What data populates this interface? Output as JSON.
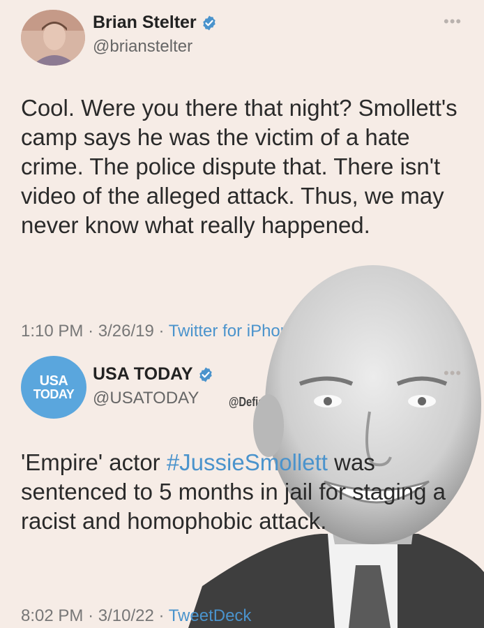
{
  "tweets": [
    {
      "name": "Brian Stelter",
      "handle": "@brianstelter",
      "text": "Cool. Were you there that night? Smollett's camp says he was the victim of a hate crime. The police dispute that. There isn't video of the alleged attack. Thus, we may never know what really happened.",
      "time": "1:10 PM",
      "date": "3/26/19",
      "source": "Twitter for iPhone",
      "more_icon": "more-dots-icon",
      "verified_icon": "verified-badge-icon"
    },
    {
      "name": "USA TODAY",
      "handle": "@USATODAY",
      "logo_line1": "USA",
      "logo_line2": "TODAY",
      "text_before": "'Empire' actor ",
      "hashtag": "#JussieSmollett",
      "text_after": " was sentenced to 5 months in jail for staging a racist and homophobic attack.",
      "time": "8:02 PM",
      "date": "3/10/22",
      "source": "TweetDeck",
      "more_icon": "more-dots-icon",
      "verified_icon": "verified-badge-icon"
    }
  ],
  "separator": "·",
  "watermark": "@DefiantLs",
  "colors": {
    "background": "#f6ece6",
    "link": "#4a93cc",
    "verified": "#4a93cc",
    "usa_today_blue": "#5aa6dd"
  }
}
